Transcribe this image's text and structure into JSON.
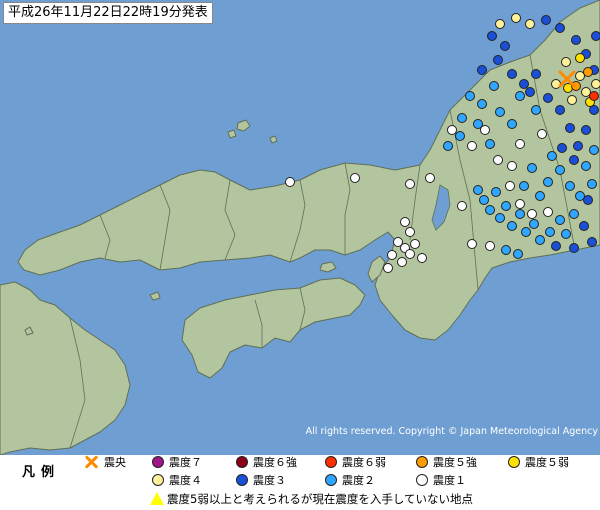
{
  "title": "平成26年11月22日22時19分発表",
  "copyright": "All rights reserved. Copyright © Japan Meteorological Agency",
  "colors": {
    "sea": "#6f9fd2",
    "land": "#b3c59f",
    "land_border": "#5f6f55",
    "epicenter": "#ff8a00",
    "shindo_7": "#a0158a",
    "shindo_6plus": "#8b0016",
    "shindo_6minus": "#ff2e00",
    "shindo_5plus": "#ff9c00",
    "shindo_5minus": "#ffe100",
    "shindo_4": "#fff09a",
    "shindo_3": "#1a4fd8",
    "shindo_2": "#2fa6ff",
    "shindo_1": "#ffffff",
    "triangle": "#ffff00"
  },
  "legend": {
    "title": "凡例",
    "epicenter": "震央",
    "items": [
      {
        "label": "震度７",
        "color": "#a0158a"
      },
      {
        "label": "震度６強",
        "color": "#8b0016"
      },
      {
        "label": "震度６弱",
        "color": "#ff2e00"
      },
      {
        "label": "震度５強",
        "color": "#ff9c00"
      },
      {
        "label": "震度５弱",
        "color": "#ffe100"
      },
      {
        "label": "震度４",
        "color": "#fff09a"
      },
      {
        "label": "震度３",
        "color": "#1a4fd8"
      },
      {
        "label": "震度２",
        "color": "#2fa6ff"
      },
      {
        "label": "震度１",
        "color": "#ffffff"
      }
    ],
    "triangle_note": "震度5弱以上と考えられるが現在震度を入手していない地点"
  }
}
